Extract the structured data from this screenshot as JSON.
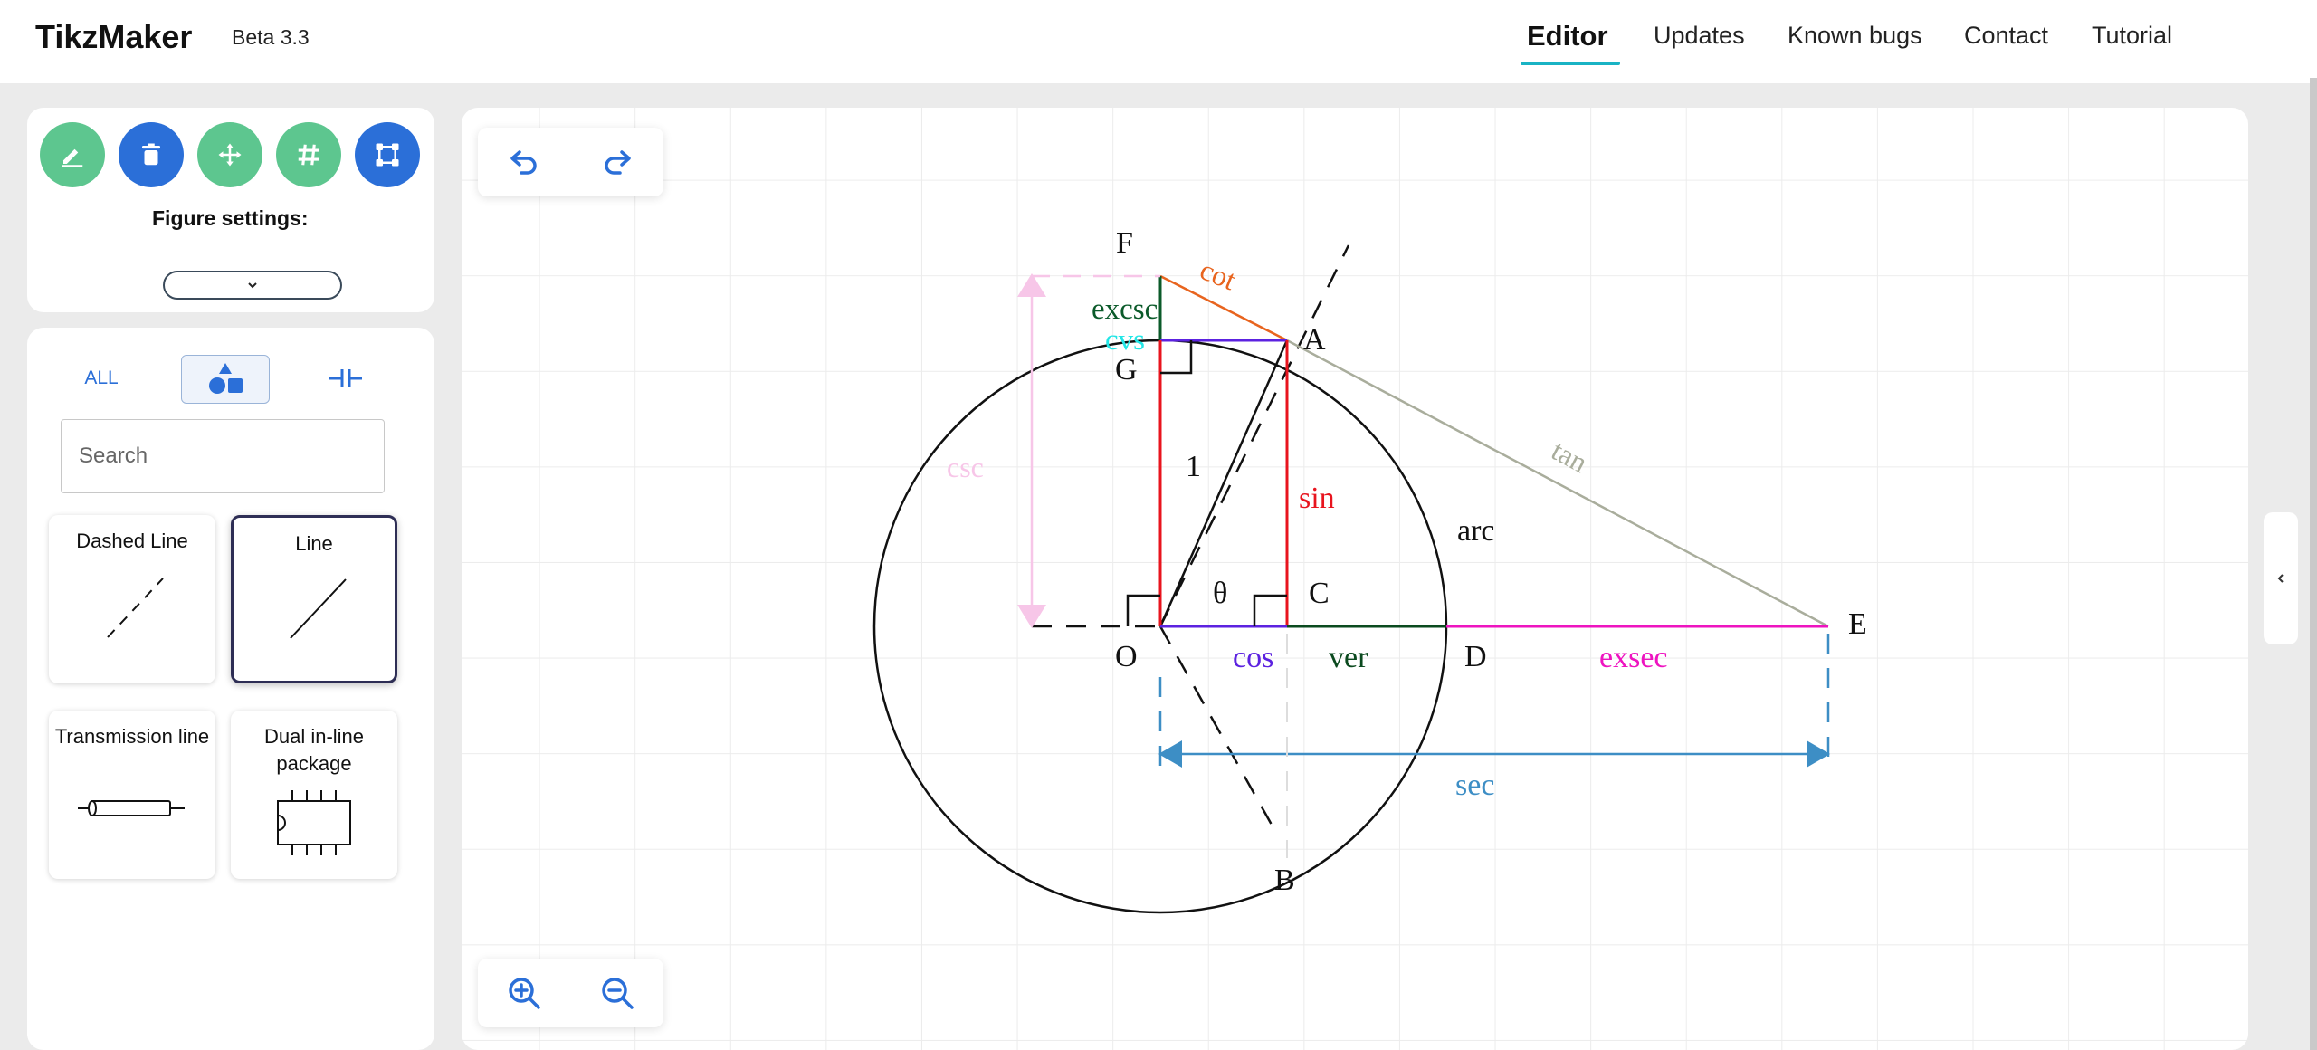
{
  "header": {
    "brand": "TikzMaker",
    "version": "Beta 3.3",
    "nav": {
      "editor": "Editor",
      "updates": "Updates",
      "known_bugs": "Known bugs",
      "contact": "Contact",
      "tutorial": "Tutorial"
    }
  },
  "toolbar": {
    "tools": [
      {
        "icon": "pencil-icon",
        "color": "#5dc68f"
      },
      {
        "icon": "trash-icon",
        "color": "#2b6fd8"
      },
      {
        "icon": "move-icon",
        "color": "#5dc68f"
      },
      {
        "icon": "grid-icon",
        "color": "#5dc68f"
      },
      {
        "icon": "bounding-box-icon",
        "color": "#2b6fd8"
      }
    ],
    "figure_settings_label": "Figure settings:"
  },
  "library": {
    "tabs": {
      "all": "ALL"
    },
    "search_placeholder": "Search",
    "items": [
      {
        "label": "Dashed Line"
      },
      {
        "label": "Line",
        "selected": true
      },
      {
        "label": "Transmission line"
      },
      {
        "label": "Dual in-line package"
      }
    ]
  },
  "figure": {
    "labels": {
      "F": "F",
      "A": "A",
      "G": "G",
      "C": "C",
      "O": "O",
      "D": "D",
      "E": "E",
      "B": "B",
      "cot": "cot",
      "excsc": "excsc",
      "cvs": "cvs",
      "csc": "csc",
      "one": "1",
      "sin": "sin",
      "arc": "arc",
      "tan": "tan",
      "theta": "θ",
      "cos": "cos",
      "ver": "ver",
      "exsec": "exsec",
      "sec": "sec"
    },
    "colors": {
      "cot": "#e8641e",
      "excsc": "#0b5a2a",
      "cvs": "#22e6e6",
      "csc": "#f7c6e8",
      "sin": "#e8141e",
      "tan": "#a9ad9c",
      "cos": "#5c22e0",
      "ver": "#0b4a1f",
      "exsec": "#ee14c0",
      "sec": "#3d8ec5",
      "black": "#111111"
    }
  }
}
